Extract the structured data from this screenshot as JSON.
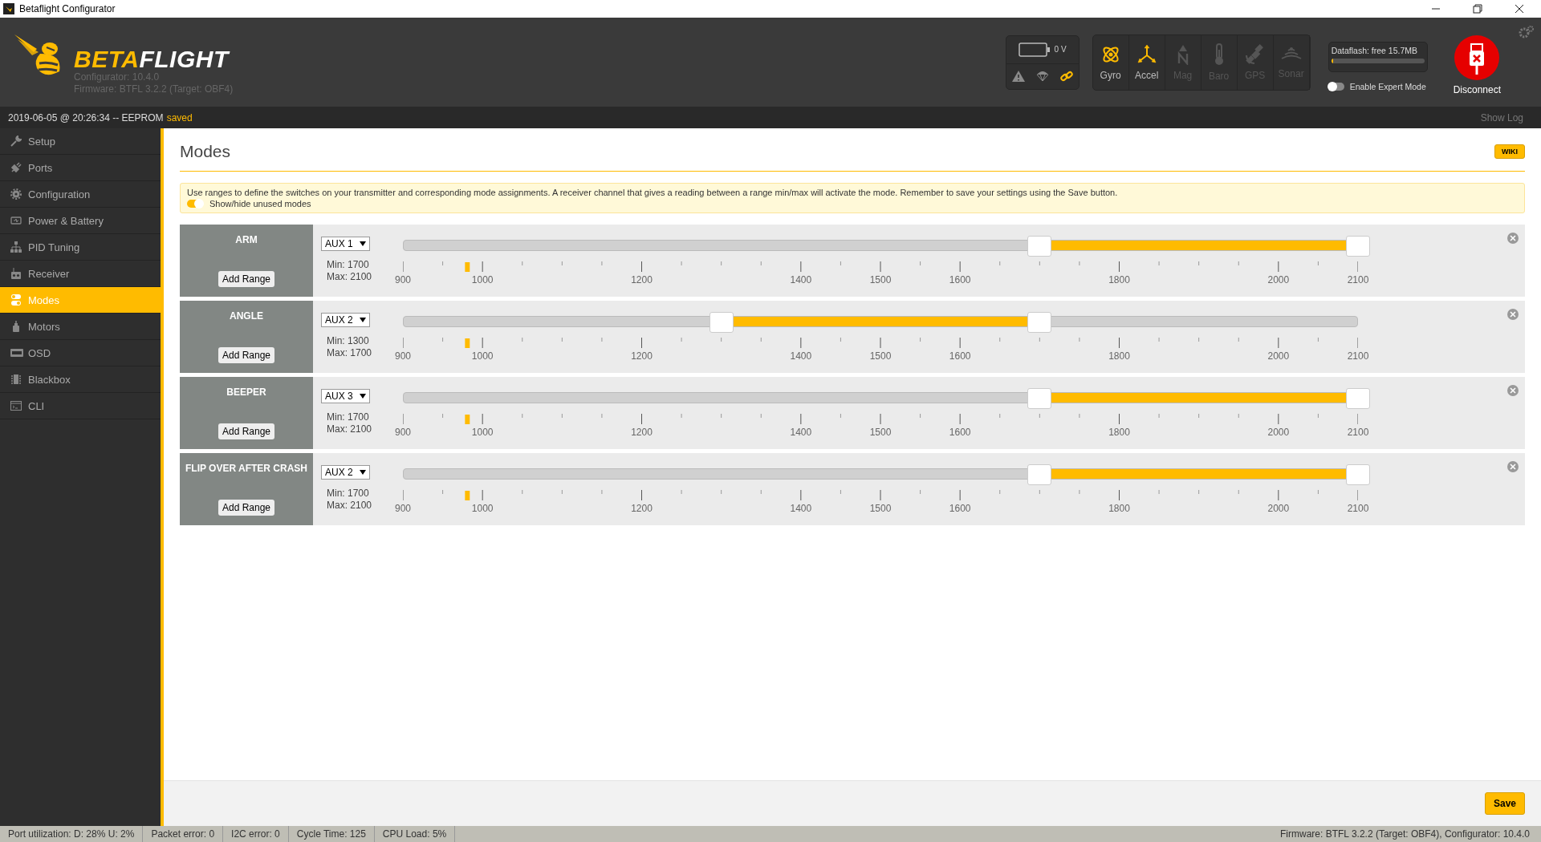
{
  "window": {
    "title": "Betaflight Configurator"
  },
  "header": {
    "logo": {
      "part_1": "BETA",
      "part_2": "FLIGHT"
    },
    "configurator_version": "Configurator: 10.4.0",
    "firmware": "Firmware: BTFL 3.2.2 (Target: OBF4)",
    "battery": {
      "voltage": "0 V"
    },
    "status_icons": [
      {
        "active": false
      },
      {
        "active": false
      },
      {
        "active": true
      }
    ],
    "sensors": [
      {
        "label": "Gyro",
        "active": true
      },
      {
        "label": "Accel",
        "active": true
      },
      {
        "label": "Mag",
        "active": false
      },
      {
        "label": "Baro",
        "active": false
      },
      {
        "label": "GPS",
        "active": false
      },
      {
        "label": "Sonar",
        "active": false
      }
    ],
    "dataflash": {
      "label": "Dataflash: free 15.7MB",
      "level": 0.01
    },
    "expert_mode": {
      "label": "Enable Expert Mode",
      "on": false
    },
    "disconnect": {
      "label": "Disconnect"
    }
  },
  "log": {
    "message": "2019-06-05 @ 20:26:34 -- EEPROM",
    "status": "saved",
    "show_log": "Show Log"
  },
  "sidebar": {
    "items": [
      {
        "label": "Setup",
        "selected": false
      },
      {
        "label": "Ports",
        "selected": false
      },
      {
        "label": "Configuration",
        "selected": false
      },
      {
        "label": "Power & Battery",
        "selected": false
      },
      {
        "label": "PID Tuning",
        "selected": false
      },
      {
        "label": "Receiver",
        "selected": false
      },
      {
        "label": "Modes",
        "selected": true
      },
      {
        "label": "Motors",
        "selected": false
      },
      {
        "label": "OSD",
        "selected": false
      },
      {
        "label": "Blackbox",
        "selected": false
      },
      {
        "label": "CLI",
        "selected": false
      }
    ]
  },
  "page": {
    "title": "Modes",
    "wiki": "WIKI",
    "info": "Use ranges to define the switches on your transmitter and corresponding mode assignments. A receiver channel that gives a reading between a range min/max will activate the mode. Remember to save your settings using the Save button.",
    "unused_toggle": {
      "label": "Show/hide unused modes",
      "on": true
    },
    "modes": [
      {
        "name": "ARM",
        "add_range": "Add Range",
        "channel": "AUX 1",
        "min": "Min: 1700",
        "max": "Max: 2100",
        "level": 0.07,
        "scale": [
          "900",
          "1000",
          "1200",
          "1400",
          "1500",
          "1600",
          "1800",
          "2000",
          "2100"
        ]
      },
      {
        "name": "ANGLE",
        "add_range": "Add Range",
        "channel": "AUX 2",
        "min": "Min: 1300",
        "max": "Max: 1700",
        "level": 0.07,
        "scale": [
          "900",
          "1000",
          "1200",
          "1400",
          "1500",
          "1600",
          "1800",
          "2000",
          "2100"
        ]
      },
      {
        "name": "BEEPER",
        "add_range": "Add Range",
        "channel": "AUX 3",
        "min": "Min: 1700",
        "max": "Max: 2100",
        "level": 0.07,
        "scale": [
          "900",
          "1000",
          "1200",
          "1400",
          "1500",
          "1600",
          "1800",
          "2000",
          "2100"
        ]
      },
      {
        "name": "FLIP OVER AFTER CRASH",
        "add_range": "Add Range",
        "channel": "AUX 2",
        "min": "Min: 1700",
        "max": "Max: 2100",
        "level": 0.07,
        "scale": [
          "900",
          "1000",
          "1200",
          "1400",
          "1500",
          "1600",
          "1800",
          "2000",
          "2100"
        ]
      }
    ],
    "save": "Save"
  },
  "status_bar": {
    "items": [
      "Port utilization: D: 28% U: 2%",
      "Packet error: 0",
      "I2C error: 0",
      "Cycle Time: 125",
      "CPU Load: 5%"
    ],
    "firmware": "Firmware: BTFL 3.2.2 (Target: OBF4), Configurator: 10.4.0"
  }
}
